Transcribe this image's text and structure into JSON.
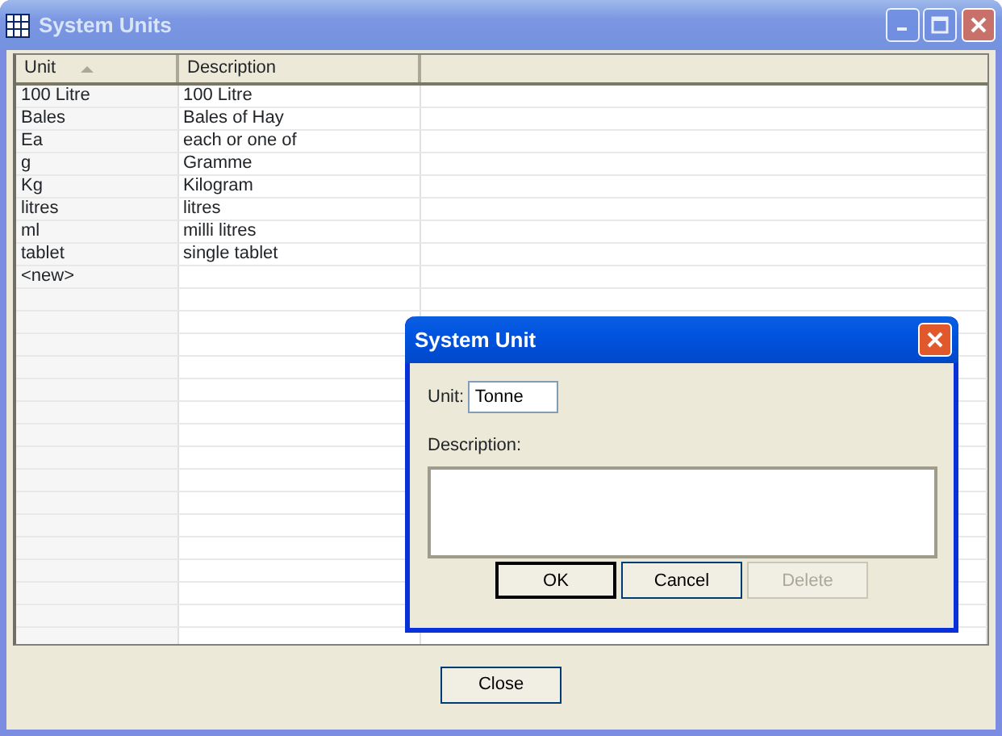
{
  "window": {
    "title": "System Units",
    "active": false
  },
  "table": {
    "columns": [
      {
        "label": "Unit",
        "sorted": true
      },
      {
        "label": "Description",
        "sorted": false
      }
    ],
    "rows": [
      {
        "cells": [
          "100 Litre",
          "100 Litre"
        ]
      },
      {
        "cells": [
          "Bales",
          "Bales of Hay"
        ]
      },
      {
        "cells": [
          "Ea",
          "each or one of"
        ]
      },
      {
        "cells": [
          "g",
          "Gramme"
        ]
      },
      {
        "cells": [
          "Kg",
          "Kilogram"
        ]
      },
      {
        "cells": [
          "litres",
          "litres"
        ]
      },
      {
        "cells": [
          "ml",
          "milli litres"
        ]
      },
      {
        "cells": [
          "tablet",
          "single tablet"
        ]
      },
      {
        "cells": [
          "<new>"
        ]
      }
    ]
  },
  "footer_buttons": [
    {
      "label": "Close",
      "default": false,
      "disabled": false
    }
  ],
  "dialog": {
    "title": "System Unit",
    "active": true,
    "unit": {
      "label": "Unit:",
      "value": "Tonne"
    },
    "description": {
      "label": "Description:"
    },
    "buttons": [
      {
        "label": "OK",
        "default": true,
        "disabled": false
      },
      {
        "label": "Cancel",
        "default": false,
        "disabled": false
      },
      {
        "label": "Delete",
        "default": false,
        "disabled": true
      }
    ]
  }
}
